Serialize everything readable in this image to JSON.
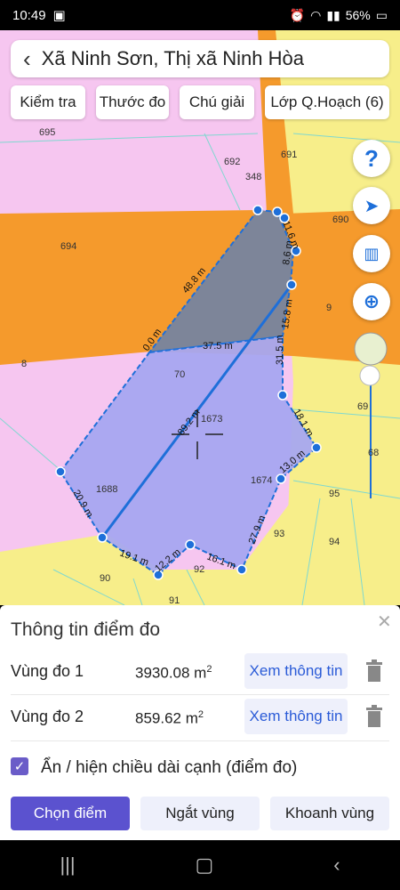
{
  "status_bar": {
    "time": "10:49",
    "battery": "56%"
  },
  "header": {
    "title": "Xã Ninh Sơn, Thị xã Ninh Hòa"
  },
  "toolbar": {
    "check_label": "Kiểm tra",
    "ruler_label": "Thước đo",
    "legend_label": "Chú giải",
    "layer_label": "Lớp Q.Hoạch (6)"
  },
  "fabs": {
    "help": "?"
  },
  "map": {
    "parcels": [
      "695",
      "692",
      "348",
      "691",
      "690",
      "694",
      "9",
      "8",
      "70",
      "1673",
      "69",
      "68",
      "1688",
      "1674",
      "95",
      "93",
      "94",
      "90",
      "92",
      "91"
    ],
    "edge_labels": [
      "48.8 m",
      "11.6 m",
      "8.6 m",
      "15.8 m",
      "31.5 m",
      "37.5 m",
      "0.0 m",
      "89.2 m",
      "18.1 m",
      "13.0 m",
      "27.9 m",
      "16.1 m",
      "12.2 m",
      "19.1 m",
      "20.9 m"
    ],
    "colors": {
      "pink_zone": "#f6c6f0",
      "orange_zone": "#f59a2c",
      "yellow_zone": "#f7ee8a",
      "region1_fill": "#a7a6f0",
      "region2_fill": "#7d8599",
      "line_blue": "#1e6fd9"
    }
  },
  "panel": {
    "title": "Thông tin điểm đo",
    "rows": [
      {
        "label": "Vùng đo 1",
        "value": "3930.08 m",
        "unit_sup": "2",
        "button": "Xem thông tin"
      },
      {
        "label": "Vùng đo 2",
        "value": "859.62 m",
        "unit_sup": "2",
        "button": "Xem thông tin"
      }
    ],
    "checkbox_label": "Ẩn / hiện chiều dài cạnh (điểm đo)",
    "buttons": {
      "select_point": "Chọn điểm",
      "break_region": "Ngắt vùng",
      "enclose_region": "Khoanh vùng"
    }
  }
}
